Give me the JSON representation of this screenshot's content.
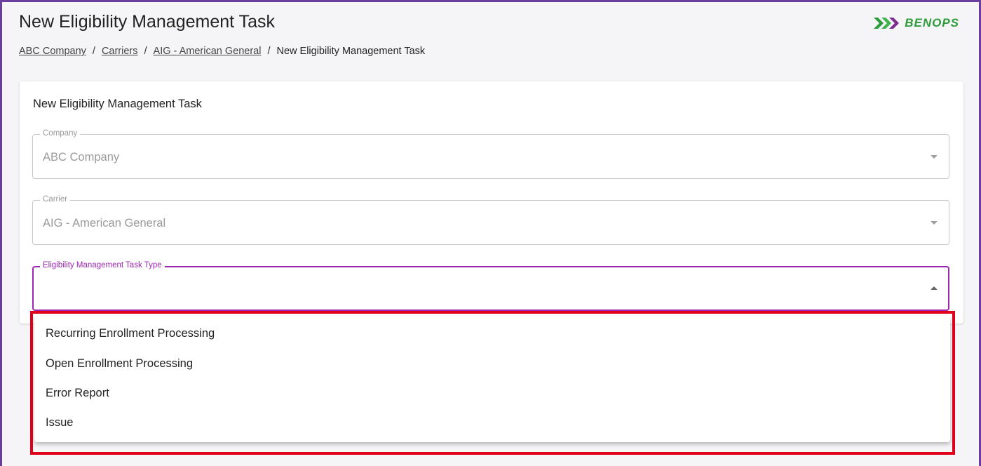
{
  "header": {
    "title": "New Eligibility Management Task",
    "logo_text": "BENOPS"
  },
  "breadcrumb": {
    "items": [
      "ABC Company",
      "Carriers",
      "AIG - American General"
    ],
    "separator": "/",
    "current": "New Eligibility Management Task"
  },
  "form": {
    "title": "New Eligibility Management Task",
    "company": {
      "label": "Company",
      "value": "ABC Company"
    },
    "carrier": {
      "label": "Carrier",
      "value": "AIG - American General"
    },
    "task_type": {
      "label": "Eligibility Management Task Type",
      "value": ""
    }
  },
  "dropdown": {
    "options": [
      "Recurring Enrollment Processing",
      "Open Enrollment Processing",
      "Error Report",
      "Issue"
    ]
  },
  "colors": {
    "frame_border": "#6a3ea1",
    "focus": "#9c27b0",
    "logo": "#2e9b3a",
    "highlight": "#e0001b"
  }
}
